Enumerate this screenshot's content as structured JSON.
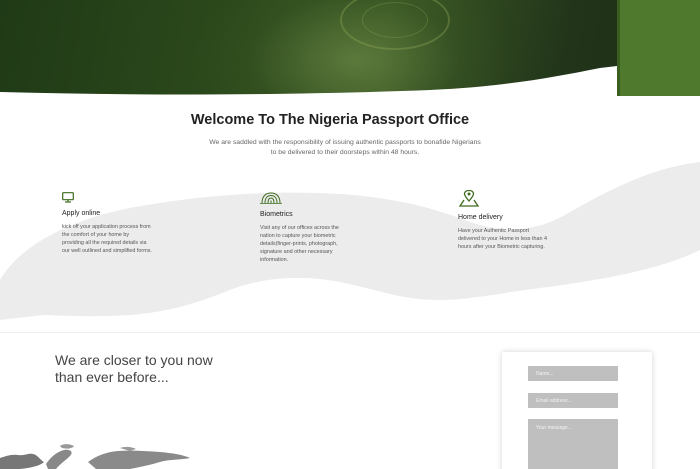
{
  "intro": {
    "title": "Welcome To The Nigeria Passport Office",
    "subtitle_line1": "We are saddled with the responsibility of issuing authentic passports to bonafide Nigerians",
    "subtitle_line2": "to be delivered to their doorsteps within 48 hours."
  },
  "features": [
    {
      "icon": "monitor-icon",
      "title": "Apply online",
      "text": "kick off your application process from the comfort of your home by providing all the required details via our well outlined and simplified forms."
    },
    {
      "icon": "fingerprint-icon",
      "title": "Biometrics",
      "text": "Visit any of our offices across the nation to capture your biometric details(finger-prints, photograph, signature and other necessary information."
    },
    {
      "icon": "location-pin-icon",
      "title": "Home delivery",
      "text": "Have your Authentic Passport delivered to your Home in less than 4 hours after your Biometric capturing."
    }
  ],
  "closer": {
    "line1": "We are closer to you now",
    "line2": "than ever before..."
  },
  "contact_form": {
    "name_placeholder": "Name...",
    "email_placeholder": "Email address...",
    "message_placeholder": "Your message..."
  },
  "colors": {
    "accent_green": "#4f7a2e",
    "icon_green": "#3d6b1f",
    "wave_gray": "#ececec",
    "field_gray": "#bfbfbf"
  }
}
